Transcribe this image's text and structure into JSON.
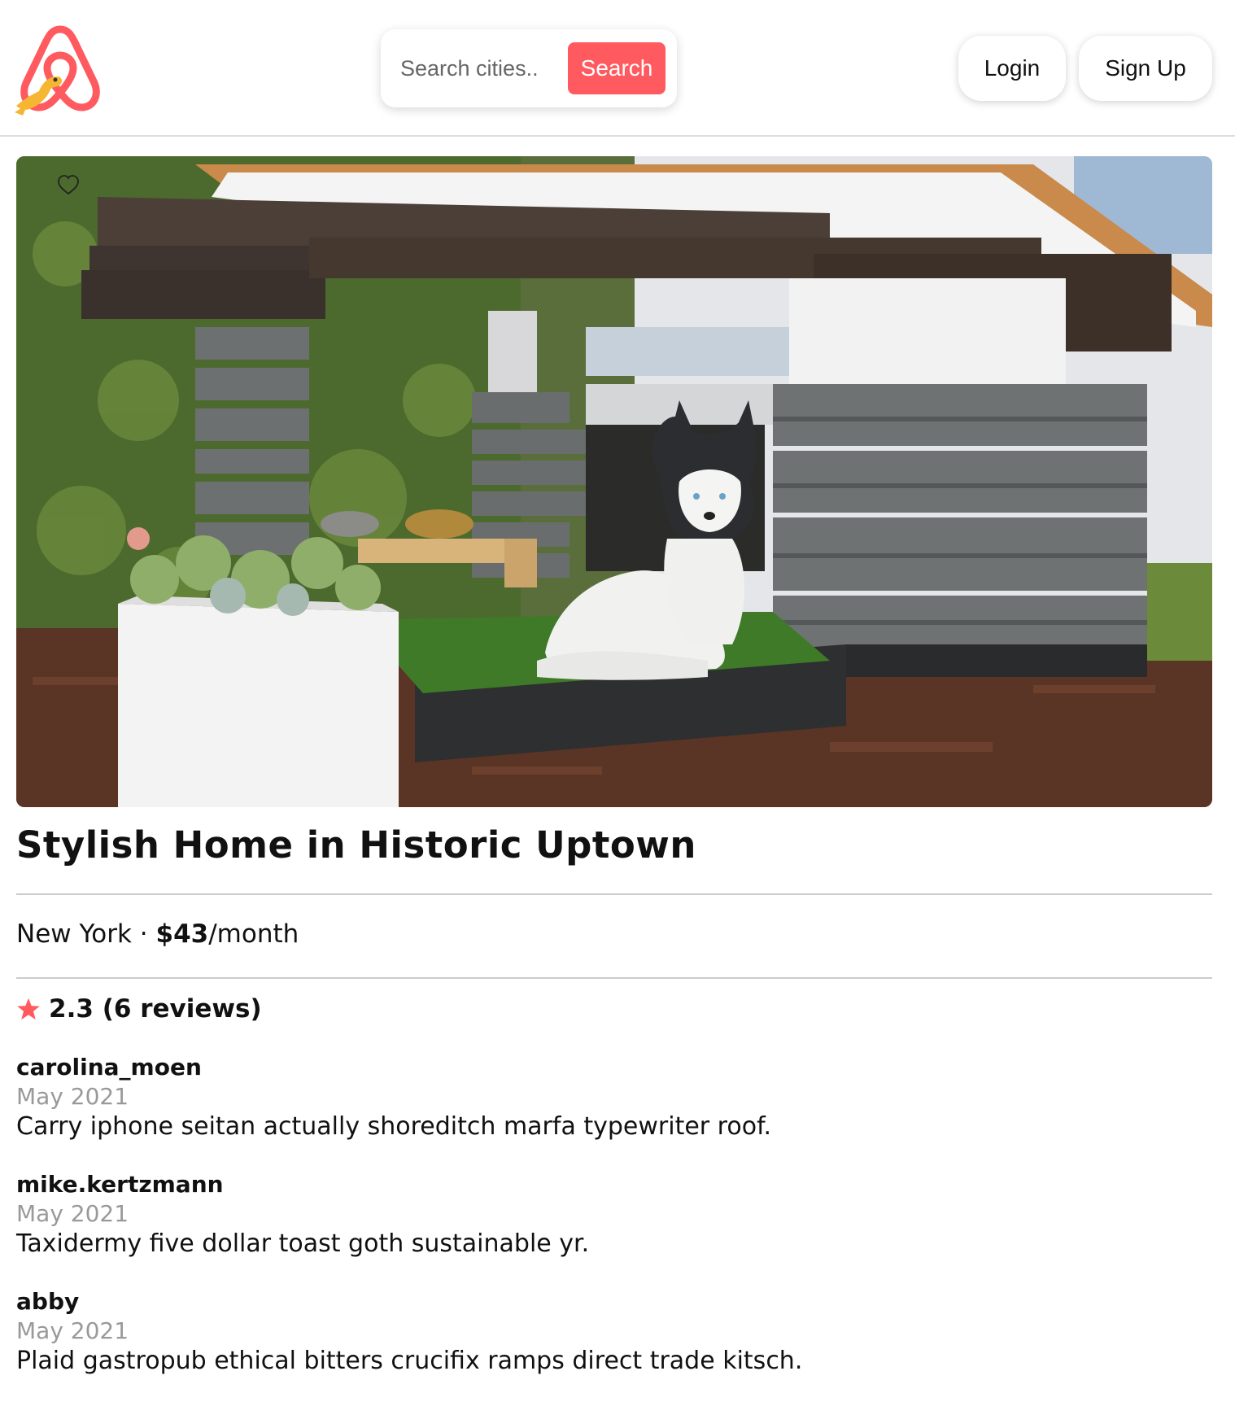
{
  "header": {
    "search": {
      "placeholder": "Search cities...",
      "button_label": "Search"
    },
    "login_label": "Login",
    "signup_label": "Sign Up"
  },
  "listing": {
    "title": "Stylish Home in Historic Uptown",
    "city": "New York",
    "separator": " · ",
    "price": "$43",
    "price_unit": "/month",
    "rating": {
      "icon": "star-icon",
      "label": "2.3 (6 reviews)"
    },
    "image": {
      "favorite_icon": "heart-icon"
    }
  },
  "reviews": [
    {
      "user": "carolina_moen",
      "date": "May 2021",
      "text": "Carry iphone seitan actually shoreditch marfa typewriter roof."
    },
    {
      "user": "mike.kertzmann",
      "date": "May 2021",
      "text": "Taxidermy five dollar toast goth sustainable yr."
    },
    {
      "user": "abby",
      "date": "May 2021",
      "text": "Plaid gastropub ethical bitters crucifix ramps direct trade kitsch."
    }
  ],
  "colors": {
    "accent": "#ff5a5f",
    "logo_yellow": "#f5b731",
    "divider": "#cccccc",
    "muted_text": "#999999"
  }
}
